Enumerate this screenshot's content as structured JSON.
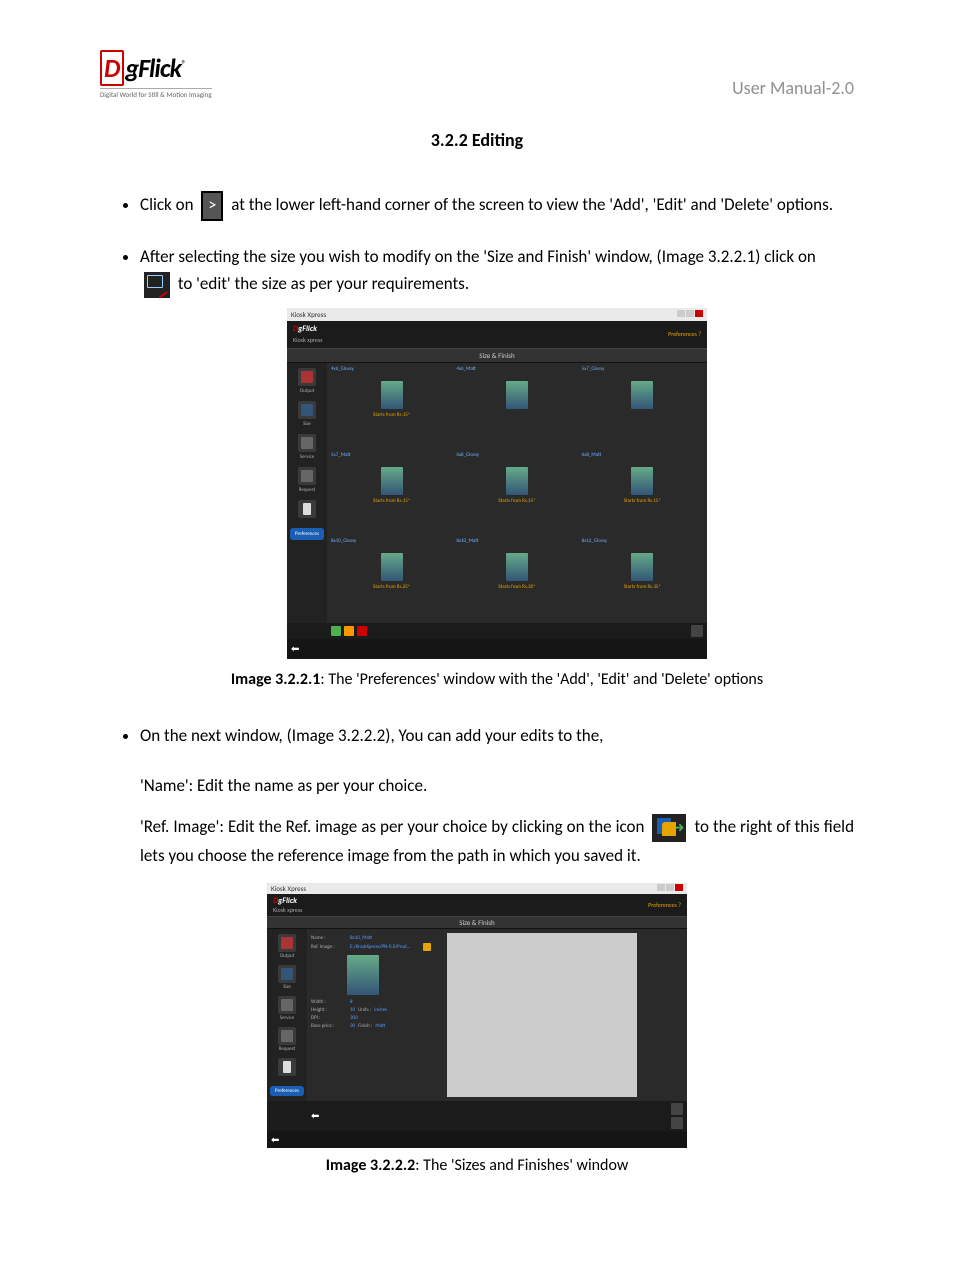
{
  "header": {
    "logo_letter": "D",
    "logo_rest": "gFlick",
    "logo_tm": "®",
    "logo_tag": "Digital World for Still & Motion Imaging",
    "right_label": "User Manual-2.0"
  },
  "section_title": "3.2.2 Editing",
  "b1_pre": "Click on",
  "b1_post": " at the lower left-hand corner of the screen to view the 'Add', 'Edit' and 'Delete' options.",
  "b2_pre": "After selecting the size you wish to modify on the 'Size and Finish' window, (Image 3.2.2.1) click on ",
  "b2_post": " to 'edit' the size as per your requirements.",
  "caption1_bold": "Image 3.2.2.1",
  "caption1_rest": ": The 'Preferences' window with the 'Add', 'Edit' and 'Delete' options",
  "b3": "On the next window, (Image 3.2.2.2), You can add your edits to the,",
  "p_name": "'Name': Edit the name as per your choice.",
  "p_ref_pre": "'Ref. Image': Edit the Ref. image as per your choice by clicking on the icon ",
  "p_ref_post": " to the right of this field lets you choose the reference image from the path in which you saved it.",
  "caption2_bold": "Image 3.2.2.2",
  "caption2_rest": ": The 'Sizes and Finishes' window",
  "ss": {
    "window_title": "Kiosk Xpress",
    "brand_letter": "D",
    "brand_rest": "gFlick",
    "brand_sub": "Kiosk xpress",
    "pref_link": "Preferences ?",
    "section": "Size & Finish",
    "sidebar": {
      "output": "Output",
      "size": "Size",
      "service": "Service",
      "request": "Request",
      "pref": "Preferences"
    },
    "grid": [
      {
        "label": "4x6_Glossy",
        "price": "Starts from Rs.15*"
      },
      {
        "label": "4x6_Matt",
        "price": ""
      },
      {
        "label": "5x7_Glossy",
        "price": ""
      },
      {
        "label": "5x7_Matt",
        "price": "Starts from Rs.15*"
      },
      {
        "label": "6x8_Glossy",
        "price": "Starts from Rs.15*"
      },
      {
        "label": "6x8_Matt",
        "price": "Starts from Rs.15*"
      },
      {
        "label": "8x10_Glossy",
        "price": "Starts from Rs.25*"
      },
      {
        "label": "8x10_Matt",
        "price": "Starts from Rs.30*"
      },
      {
        "label": "8x12_Glossy",
        "price": "Starts from Rs.35*"
      }
    ],
    "form": {
      "name_label": "Name :",
      "name_val": "8x10_Matt",
      "ref_label": "Ref. Image :",
      "ref_val": "E:/KioskXpress/PN-0.0/Prod...",
      "width_label": "Width :",
      "width_val": "8",
      "height_label": "Height :",
      "height_val": "10",
      "units_label": "Units :",
      "units_val": "inches",
      "dpi_label": "DPI :",
      "dpi_val": "300",
      "base_label": "Base price :",
      "base_val": "30",
      "finish_label": "Finish :",
      "finish_val": "Matt"
    }
  }
}
